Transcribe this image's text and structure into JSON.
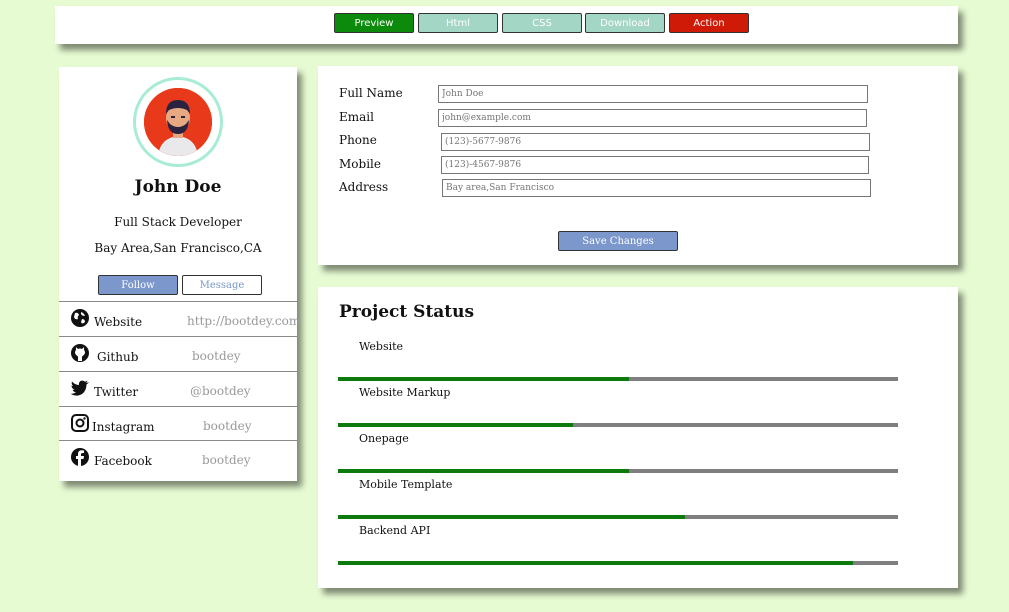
{
  "toolbar": {
    "buttons": [
      {
        "label": "Preview",
        "color": "#0b8a0b"
      },
      {
        "label": "Html",
        "color": "#a3d6c4"
      },
      {
        "label": "CSS",
        "color": "#a3d6c4"
      },
      {
        "label": "Download",
        "color": "#a3d6c4"
      },
      {
        "label": "Action",
        "color": "#d01a08"
      }
    ]
  },
  "profile": {
    "name": "John Doe",
    "role": "Full Stack Developer",
    "location": "Bay Area,San Francisco,CA",
    "follow_label": "Follow",
    "message_label": "Message",
    "social": [
      {
        "label": "Website",
        "value": "http://bootdey.com",
        "icon": "globe-icon"
      },
      {
        "label": "Github",
        "value": "bootdey",
        "icon": "github-icon"
      },
      {
        "label": "Twitter",
        "value": "@bootdey",
        "icon": "twitter-icon"
      },
      {
        "label": "Instagram",
        "value": "bootdey",
        "icon": "instagram-icon"
      },
      {
        "label": "Facebook",
        "value": "bootdey",
        "icon": "facebook-icon"
      }
    ]
  },
  "form": {
    "fields": [
      {
        "label": "Full Name",
        "placeholder": "John Doe"
      },
      {
        "label": "Email",
        "placeholder": "john@example.com"
      },
      {
        "label": "Phone",
        "placeholder": "(123)-5677-9876"
      },
      {
        "label": "Mobile",
        "placeholder": "(123)-4567-9876"
      },
      {
        "label": "Address",
        "placeholder": "Bay area,San Francisco"
      }
    ],
    "save_label": "Save Changes"
  },
  "projects": {
    "title": "Project Status",
    "items": [
      {
        "label": "Website",
        "progress": 0.52
      },
      {
        "label": "Website Markup",
        "progress": 0.42
      },
      {
        "label": "Onepage",
        "progress": 0.52
      },
      {
        "label": "Mobile Template",
        "progress": 0.62
      },
      {
        "label": "Backend API",
        "progress": 0.92
      }
    ]
  }
}
